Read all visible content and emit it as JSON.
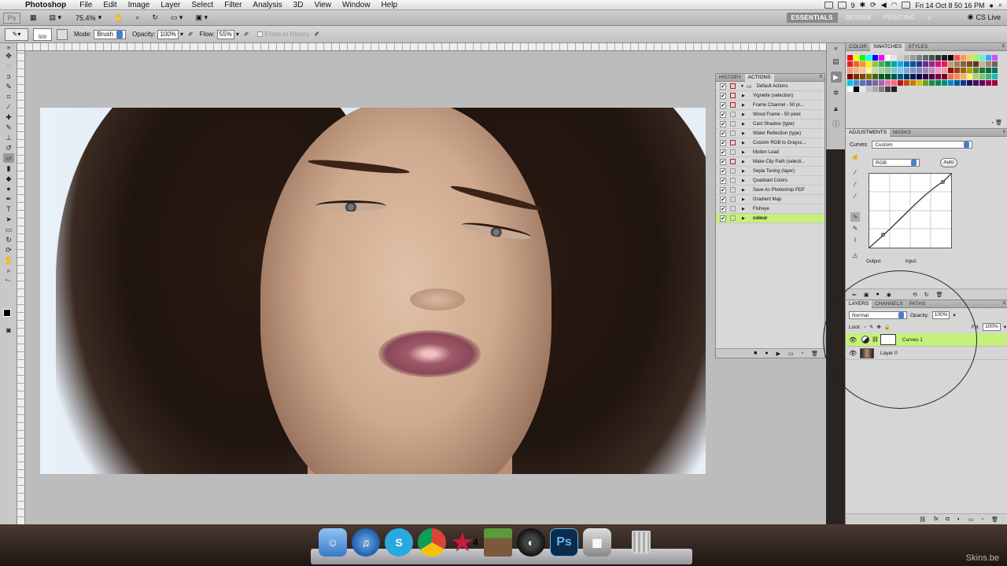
{
  "menubar": {
    "app_name": "Photoshop",
    "items": [
      "File",
      "Edit",
      "Image",
      "Layer",
      "Select",
      "Filter",
      "Analysis",
      "3D",
      "View",
      "Window",
      "Help"
    ],
    "status_extra": "9",
    "clock": "Fri 14 Oct  8 50 16 PM"
  },
  "appbar": {
    "logo": "Ps",
    "zoom": "75.4%",
    "workspaces": [
      "ESSENTIALS",
      "DESIGN",
      "PAINTING"
    ],
    "cs_live": "CS Live"
  },
  "options": {
    "brush_size": "500",
    "mode_label": "Mode:",
    "mode_value": "Brush",
    "opacity_label": "Opacity:",
    "opacity_value": "100%",
    "flow_label": "Flow:",
    "flow_value": "55%",
    "erase_to_history": "Erase to History"
  },
  "history_panel": {
    "tabs": [
      "HISTORY",
      "ACTIONS"
    ],
    "set_name": "Default Actions",
    "actions": [
      {
        "label": "Vignette (selection)",
        "red": true
      },
      {
        "label": "Frame Channel - 50 pi...",
        "red": true
      },
      {
        "label": "Wood Frame - 50 pixel",
        "red": false
      },
      {
        "label": "Cast Shadow (type)",
        "red": false
      },
      {
        "label": "Water Reflection (type)",
        "red": false
      },
      {
        "label": "Custom RGB to Graysc...",
        "red": true
      },
      {
        "label": "Molten Lead",
        "red": false
      },
      {
        "label": "Make Clip Path (selecti...",
        "red": true
      },
      {
        "label": "Sepia Toning (layer)",
        "red": false
      },
      {
        "label": "Quadrant Colors",
        "red": false
      },
      {
        "label": "Save As Photoshop PDF",
        "red": false
      },
      {
        "label": "Gradient Map",
        "red": false
      },
      {
        "label": "Fisheye",
        "red": false
      },
      {
        "label": "colour",
        "red": false
      }
    ]
  },
  "swatches_panel": {
    "tabs": [
      "COLOR",
      "SWATCHES",
      "STYLES"
    ]
  },
  "adjustments_panel": {
    "tabs": [
      "ADJUSTMENTS",
      "MASKS"
    ],
    "type_label": "Curves",
    "preset_value": "Custom",
    "channel_value": "RGB",
    "auto_label": "Auto",
    "output_label": "Output:",
    "input_label": "Input:"
  },
  "layers_panel": {
    "tabs": [
      "LAYERS",
      "CHANNELS",
      "PATHS"
    ],
    "blend_mode": "Normal",
    "opacity_label": "Opacity:",
    "opacity_value": "100%",
    "lock_label": "Lock:",
    "fill_label": "Fill:",
    "fill_value": "100%",
    "layers": [
      "Curves 1",
      "Layer 0"
    ]
  },
  "dock": {
    "ps_label": "Ps",
    "badge": "4"
  },
  "watermark": "Skins.be"
}
